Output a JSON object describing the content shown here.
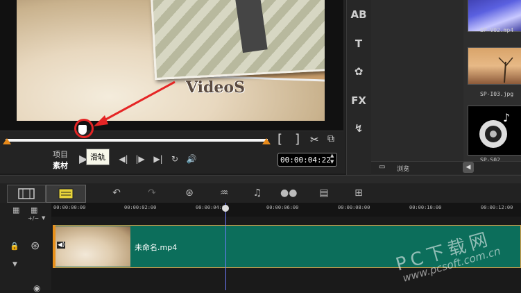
{
  "preview": {
    "video_title": "VideoS",
    "tooltip": "滑轨",
    "mode_project": "项目",
    "mode_clip": "素材",
    "timecode": "00:00:04:22",
    "trim_start": "[",
    "trim_end": "]"
  },
  "side_toolbar": [
    "AB",
    "T",
    "✿",
    "FX",
    "↯"
  ],
  "library": {
    "items": [
      {
        "name": "SP-V02.mp4"
      },
      {
        "name": "SP-I03.jpg"
      },
      {
        "name": "SP-S02"
      }
    ],
    "browse_label": "浏览"
  },
  "timeline": {
    "ruler": [
      "00:00:00:00",
      "00:00:02:00",
      "00:00:04:00",
      "00:00:06:00",
      "00:00:08:00",
      "00:00:10:00",
      "00:00:12:00"
    ],
    "clip_name": "未命名.mp4",
    "track_add_label": "+/−"
  },
  "watermark": {
    "big": "PC下载网",
    "small": "www.pcsoft.com.cn"
  },
  "colors": {
    "accent_red": "#e52525",
    "clip_teal": "#0c6e5b",
    "trim_orange": "#e88a1a",
    "playhead": "#6f7cff"
  }
}
